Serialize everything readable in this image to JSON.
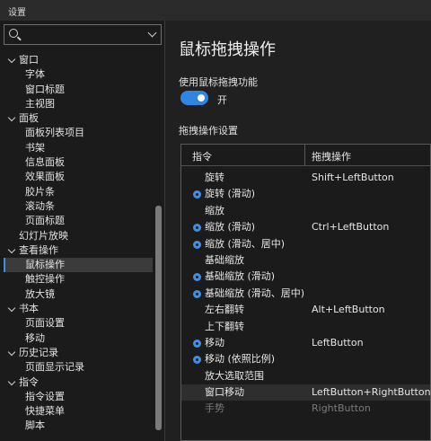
{
  "window": {
    "title": "设置"
  },
  "sidebar": {
    "search": {
      "value": "",
      "placeholder": ""
    },
    "tree": [
      {
        "label": "窗口",
        "level": 0,
        "expanded": true
      },
      {
        "label": "字体",
        "level": 1
      },
      {
        "label": "窗口标题",
        "level": 1
      },
      {
        "label": "主视图",
        "level": 1
      },
      {
        "label": "面板",
        "level": 0,
        "expanded": true
      },
      {
        "label": "面板列表项目",
        "level": 1
      },
      {
        "label": "书架",
        "level": 1
      },
      {
        "label": "信息面板",
        "level": 1
      },
      {
        "label": "效果面板",
        "level": 1
      },
      {
        "label": "胶片条",
        "level": 1
      },
      {
        "label": "滚动条",
        "level": 1
      },
      {
        "label": "页面标题",
        "level": 1
      },
      {
        "label": "幻灯片放映",
        "level": 0
      },
      {
        "label": "查看操作",
        "level": 0,
        "expanded": true
      },
      {
        "label": "鼠标操作",
        "level": 1,
        "selected": true
      },
      {
        "label": "触控操作",
        "level": 1
      },
      {
        "label": "放大镜",
        "level": 1
      },
      {
        "label": "书本",
        "level": 0,
        "expanded": true
      },
      {
        "label": "页面设置",
        "level": 1
      },
      {
        "label": "移动",
        "level": 1
      },
      {
        "label": "历史记录",
        "level": 0,
        "expanded": true
      },
      {
        "label": "页面显示记录",
        "level": 1
      },
      {
        "label": "指令",
        "level": 0,
        "expanded": true
      },
      {
        "label": "指令设置",
        "level": 1
      },
      {
        "label": "快捷菜单",
        "level": 1
      },
      {
        "label": "脚本",
        "level": 1
      }
    ]
  },
  "main": {
    "title": "鼠标拖拽操作",
    "toggle": {
      "label": "使用鼠标拖拽功能",
      "state": "开",
      "on": true
    },
    "section_label": "拖拽操作设置",
    "table": {
      "headers": [
        "指令",
        "拖拽操作"
      ],
      "rows": [
        {
          "cmd": "旋转",
          "op": "Shift+LeftButton",
          "gear": false
        },
        {
          "cmd": "旋转 (滑动)",
          "op": "",
          "gear": true
        },
        {
          "cmd": "缩放",
          "op": "",
          "gear": false
        },
        {
          "cmd": "缩放 (滑动)",
          "op": "Ctrl+LeftButton",
          "gear": true
        },
        {
          "cmd": "缩放 (滑动、居中)",
          "op": "",
          "gear": true
        },
        {
          "cmd": "基础缩放",
          "op": "",
          "gear": false
        },
        {
          "cmd": "基础缩放 (滑动)",
          "op": "",
          "gear": true
        },
        {
          "cmd": "基础缩放 (滑动、居中)",
          "op": "",
          "gear": true
        },
        {
          "cmd": "左右翻转",
          "op": "Alt+LeftButton",
          "gear": false
        },
        {
          "cmd": "上下翻转",
          "op": "",
          "gear": false
        },
        {
          "cmd": "移动",
          "op": "LeftButton",
          "gear": true
        },
        {
          "cmd": "移动 (依照比例)",
          "op": "",
          "gear": true
        },
        {
          "cmd": "放大选取范围",
          "op": "",
          "gear": false
        },
        {
          "cmd": "窗口移动",
          "op": "LeftButton+RightButton",
          "gear": false,
          "selected": true
        },
        {
          "cmd": "手势",
          "op": "RightButton",
          "gear": false,
          "dim": true
        }
      ]
    }
  },
  "colors": {
    "accent": "#2f86e0",
    "background": "#1f1f1f",
    "panel": "#1b1b1b"
  },
  "icons": {
    "search": "search-icon",
    "dropdown": "chevron-down-icon",
    "expand": "chevron-down-icon",
    "settings": "gear-icon"
  }
}
